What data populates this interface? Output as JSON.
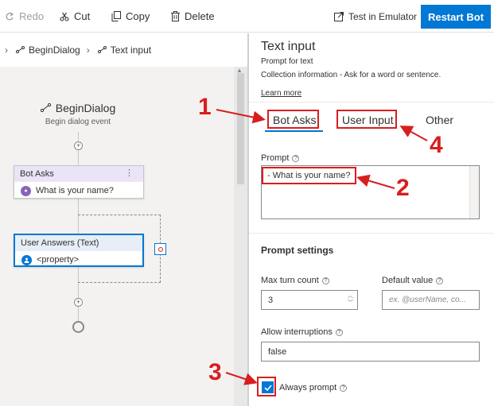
{
  "toolbar": {
    "redo_label": "Redo",
    "cut_label": "Cut",
    "copy_label": "Copy",
    "delete_label": "Delete",
    "test_label": "Test in Emulator",
    "restart_label": "Restart Bot"
  },
  "breadcrumb": {
    "items": [
      "BeginDialog",
      "Text input"
    ]
  },
  "canvas": {
    "trigger_title": "BeginDialog",
    "trigger_subtitle": "Begin dialog event",
    "node1": {
      "title": "Bot Asks",
      "body": "What is your name?"
    },
    "node2": {
      "title": "User Answers (Text)",
      "body": "<property>"
    }
  },
  "panel": {
    "title": "Text input",
    "subtitle": "Prompt for text",
    "description": "Collection information - Ask for a word or sentence.",
    "learn_more": "Learn more",
    "tabs": [
      "Bot Asks",
      "User Input",
      "Other"
    ],
    "prompt_label": "Prompt",
    "prompt_value": "- What is your name?",
    "settings_title": "Prompt settings",
    "max_turn_label": "Max turn count",
    "max_turn_value": "3",
    "default_value_label": "Default value",
    "default_value_placeholder": "ex. @userName, co...",
    "interruptions_label": "Allow interruptions",
    "interruptions_value": "false",
    "always_prompt_label": "Always prompt",
    "always_prompt_checked": true
  },
  "annotations": [
    "1",
    "2",
    "3",
    "4"
  ],
  "colors": {
    "accent": "#0078d4",
    "annotation": "#d81e1e"
  }
}
